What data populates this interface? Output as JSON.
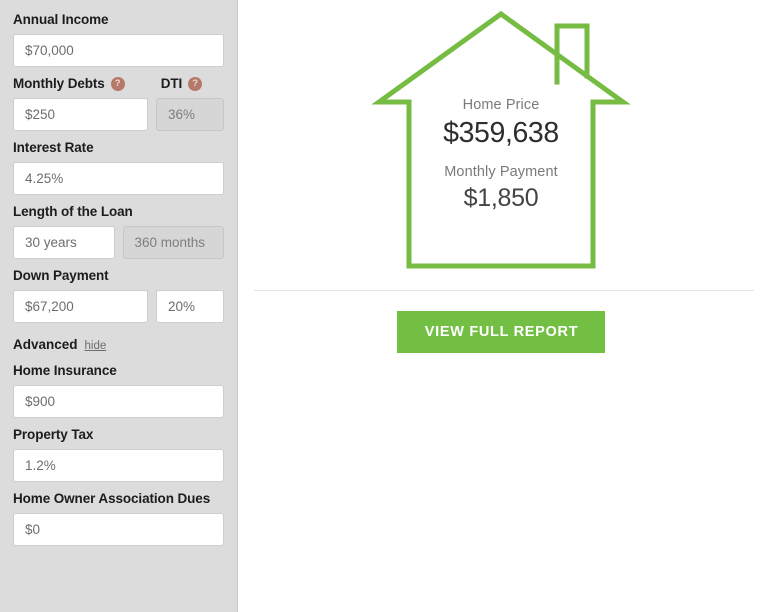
{
  "theme": {
    "sidebar_bg": "#dcdcdc",
    "accent_green": "#73bf44",
    "help_icon_bg": "#b5796a",
    "value_text": "#6e6e6e",
    "label_text": "#1c1c1c"
  },
  "sidebar": {
    "fields": [
      {
        "label": "Annual Income",
        "help": false,
        "value": "$70,000",
        "placeholder": "$70,000"
      },
      {
        "label": "Monthly Debts",
        "help": true,
        "help_glyph": "?",
        "value": "$250",
        "placeholder": "$250",
        "secondary_label": "DTI",
        "secondary_help": true,
        "secondary_value": "36%",
        "secondary_readonly": true
      },
      {
        "label": "Interest Rate",
        "help": false,
        "value": "4.25%",
        "placeholder": "4.25%"
      },
      {
        "label": "Length of the Loan",
        "help": false,
        "value": "30 years",
        "placeholder": "30 years",
        "secondary_value": "360 months",
        "secondary_readonly": true
      },
      {
        "label": "Down Payment",
        "help": false,
        "value": "$67,200",
        "placeholder": "$67,200",
        "secondary_value": "20%",
        "secondary_readonly": false
      }
    ],
    "advanced": {
      "title": "Advanced",
      "toggle_label": "hide"
    },
    "advanced_fields": [
      {
        "label": "Home Insurance",
        "value": "$900",
        "placeholder": "$900"
      },
      {
        "label": "Property Tax",
        "value": "1.2%",
        "placeholder": "1.2%"
      },
      {
        "label": "Home Owner Association Dues",
        "value": "$0",
        "placeholder": "$0"
      }
    ]
  },
  "result": {
    "house_icon": "house-outline-icon",
    "home_price_caption": "Home Price",
    "home_price_value": "$359,638",
    "monthly_payment_caption": "Monthly Payment",
    "monthly_payment_value": "$1,850",
    "cta_label": "VIEW FULL REPORT"
  }
}
